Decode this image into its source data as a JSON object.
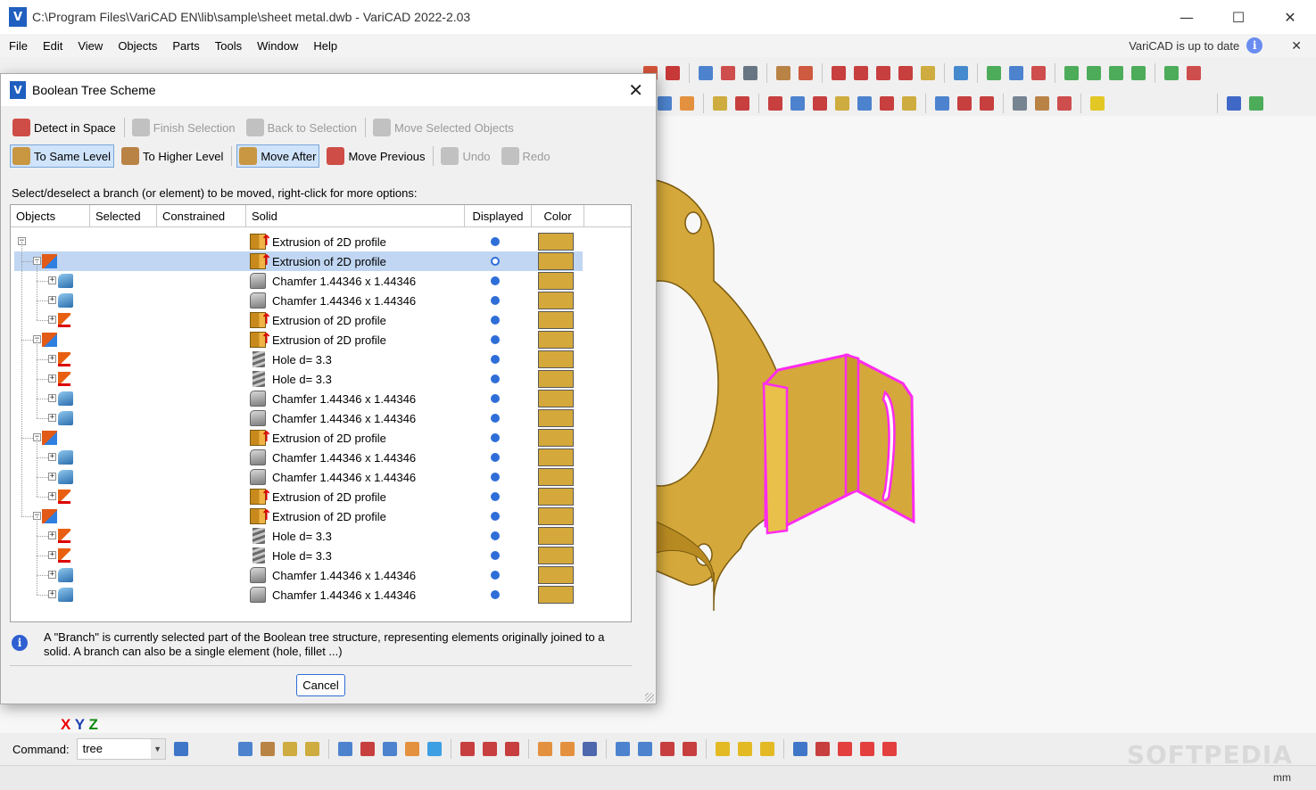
{
  "window": {
    "title": "C:\\Program Files\\VariCAD EN\\lib\\sample\\sheet metal.dwb - VariCAD 2022-2.03",
    "logo_letter": "V",
    "controls": {
      "minimize": "—",
      "maximize": "☐",
      "close": "✕"
    }
  },
  "menu": [
    "File",
    "Edit",
    "View",
    "Objects",
    "Parts",
    "Tools",
    "Window",
    "Help"
  ],
  "update_notice": {
    "text": "VariCAD is up to date",
    "info": "i",
    "close": "✕"
  },
  "dialog": {
    "title": "Boolean Tree Scheme",
    "close": "✕",
    "toolbar1": [
      {
        "label": "Detect in Space",
        "state": "normal"
      },
      {
        "label": "Finish Selection",
        "state": "disabled"
      },
      {
        "label": "Back to Selection",
        "state": "disabled"
      },
      {
        "label": "Move Selected Objects",
        "state": "disabled"
      }
    ],
    "toolbar2": [
      {
        "label": "To Same Level",
        "state": "active"
      },
      {
        "label": "To Higher Level",
        "state": "normal"
      },
      {
        "label": "Move After",
        "state": "active"
      },
      {
        "label": "Move Previous",
        "state": "normal"
      },
      {
        "label": "Undo",
        "state": "disabled"
      },
      {
        "label": "Redo",
        "state": "disabled"
      }
    ],
    "instruction": "Select/deselect a branch (or element) to be moved, right-click for more options:",
    "columns": [
      "Objects",
      "Selected",
      "Constrained",
      "Solid",
      "Displayed",
      "Color"
    ],
    "swatch_color": "#d4a83a",
    "rows": [
      {
        "level": 0,
        "toggle": "−",
        "obj": "",
        "solid_icon": "extr",
        "solid": "Extrusion of 2D profile",
        "selected": false
      },
      {
        "level": 1,
        "toggle": "−",
        "obj": "extr",
        "solid_icon": "extr",
        "solid": "Extrusion of 2D profile",
        "selected": true
      },
      {
        "level": 2,
        "toggle": "+",
        "obj": "ch",
        "solid_icon": "ch",
        "solid": "Chamfer 1.44346 x 1.44346",
        "selected": false
      },
      {
        "level": 2,
        "toggle": "+",
        "obj": "ch",
        "solid_icon": "ch",
        "solid": "Chamfer 1.44346 x 1.44346",
        "selected": false
      },
      {
        "level": 2,
        "toggle": "+",
        "obj": "hole",
        "solid_icon": "extr",
        "solid": "Extrusion of 2D profile",
        "selected": false
      },
      {
        "level": 1,
        "toggle": "−",
        "obj": "extr",
        "solid_icon": "extr",
        "solid": "Extrusion of 2D profile",
        "selected": false
      },
      {
        "level": 2,
        "toggle": "+",
        "obj": "hole",
        "solid_icon": "hole",
        "solid": "Hole d= 3.3",
        "selected": false
      },
      {
        "level": 2,
        "toggle": "+",
        "obj": "hole",
        "solid_icon": "hole",
        "solid": "Hole d= 3.3",
        "selected": false
      },
      {
        "level": 2,
        "toggle": "+",
        "obj": "ch",
        "solid_icon": "ch",
        "solid": "Chamfer 1.44346 x 1.44346",
        "selected": false
      },
      {
        "level": 2,
        "toggle": "+",
        "obj": "ch",
        "solid_icon": "ch",
        "solid": "Chamfer 1.44346 x 1.44346",
        "selected": false
      },
      {
        "level": 1,
        "toggle": "−",
        "obj": "extr",
        "solid_icon": "extr",
        "solid": "Extrusion of 2D profile",
        "selected": false
      },
      {
        "level": 2,
        "toggle": "+",
        "obj": "ch",
        "solid_icon": "ch",
        "solid": "Chamfer 1.44346 x 1.44346",
        "selected": false
      },
      {
        "level": 2,
        "toggle": "+",
        "obj": "ch",
        "solid_icon": "ch",
        "solid": "Chamfer 1.44346 x 1.44346",
        "selected": false
      },
      {
        "level": 2,
        "toggle": "+",
        "obj": "hole",
        "solid_icon": "extr",
        "solid": "Extrusion of 2D profile",
        "selected": false
      },
      {
        "level": 1,
        "toggle": "−",
        "obj": "extr",
        "solid_icon": "extr",
        "solid": "Extrusion of 2D profile",
        "selected": false
      },
      {
        "level": 2,
        "toggle": "+",
        "obj": "hole",
        "solid_icon": "hole",
        "solid": "Hole d= 3.3",
        "selected": false
      },
      {
        "level": 2,
        "toggle": "+",
        "obj": "hole",
        "solid_icon": "hole",
        "solid": "Hole d= 3.3",
        "selected": false
      },
      {
        "level": 2,
        "toggle": "+",
        "obj": "ch",
        "solid_icon": "ch",
        "solid": "Chamfer 1.44346 x 1.44346",
        "selected": false
      },
      {
        "level": 2,
        "toggle": "+",
        "obj": "ch",
        "solid_icon": "ch",
        "solid": "Chamfer 1.44346 x 1.44346",
        "selected": false
      }
    ],
    "info_icon": "i",
    "info_text": "A \"Branch\" is currently selected part of the Boolean tree structure, representing elements originally joined to a solid. A branch can also be a single element (hole, fillet ...)",
    "cancel_label": "Cancel"
  },
  "viewport": {
    "model_color": "#d4a83a",
    "highlight_color": "#ff2bf0"
  },
  "axes": {
    "x": "X",
    "y": "Y",
    "z": "Z"
  },
  "command": {
    "label": "Command:",
    "value": "tree",
    "dropdown": "▼"
  },
  "status": {
    "unit": "mm"
  },
  "watermark": "SOFTPEDIA"
}
